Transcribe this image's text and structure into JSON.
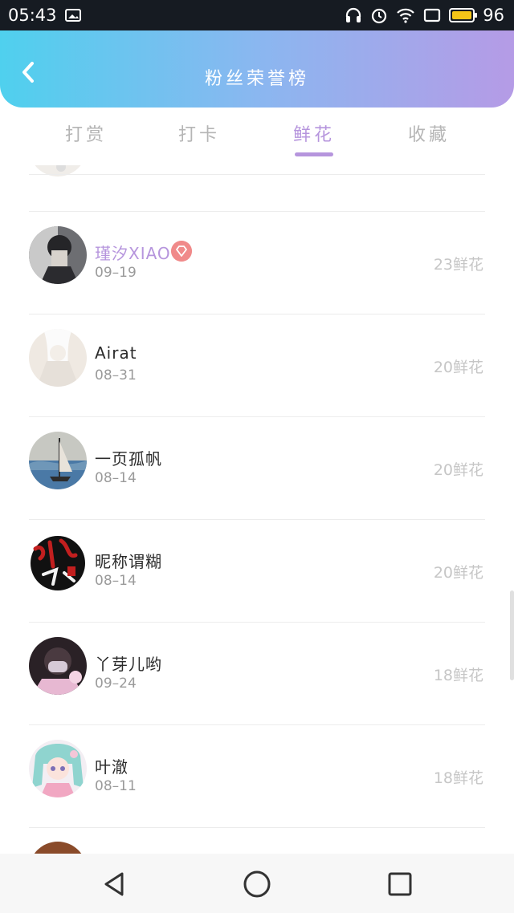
{
  "status_bar": {
    "time": "05:43",
    "battery_level": "96",
    "icons": [
      "image-icon",
      "headset-icon",
      "alarm-icon",
      "wifi-icon",
      "screen-icon",
      "battery-icon"
    ]
  },
  "header": {
    "title": "粉丝荣誉榜",
    "back_icon": "chevron-left-icon",
    "gradient_colors": [
      "#4fd0ee",
      "#b59be6"
    ]
  },
  "tabs": [
    {
      "label": "打赏",
      "active": false
    },
    {
      "label": "打卡",
      "active": false
    },
    {
      "label": "鲜花",
      "active": true
    },
    {
      "label": "收藏",
      "active": false
    }
  ],
  "fans": [
    {
      "name": "瑾汐XIAO",
      "date": "09–19",
      "count": "23鲜花",
      "vip": true
    },
    {
      "name": "Airat",
      "date": "08–31",
      "count": "20鲜花",
      "vip": false
    },
    {
      "name": "一页孤帆",
      "date": "08–14",
      "count": "20鲜花",
      "vip": false
    },
    {
      "name": "昵称谓糊",
      "date": "08–14",
      "count": "20鲜花",
      "vip": false
    },
    {
      "name": "丫芽儿哟",
      "date": "09–24",
      "count": "18鲜花",
      "vip": false
    },
    {
      "name": "叶澈",
      "date": "08–11",
      "count": "18鲜花",
      "vip": false
    }
  ],
  "nav": {
    "back": "triangle-back-icon",
    "home": "circle-home-icon",
    "recents": "square-recents-icon"
  },
  "colors": {
    "accent": "#b695dd",
    "muted": "#b5b5b5"
  }
}
